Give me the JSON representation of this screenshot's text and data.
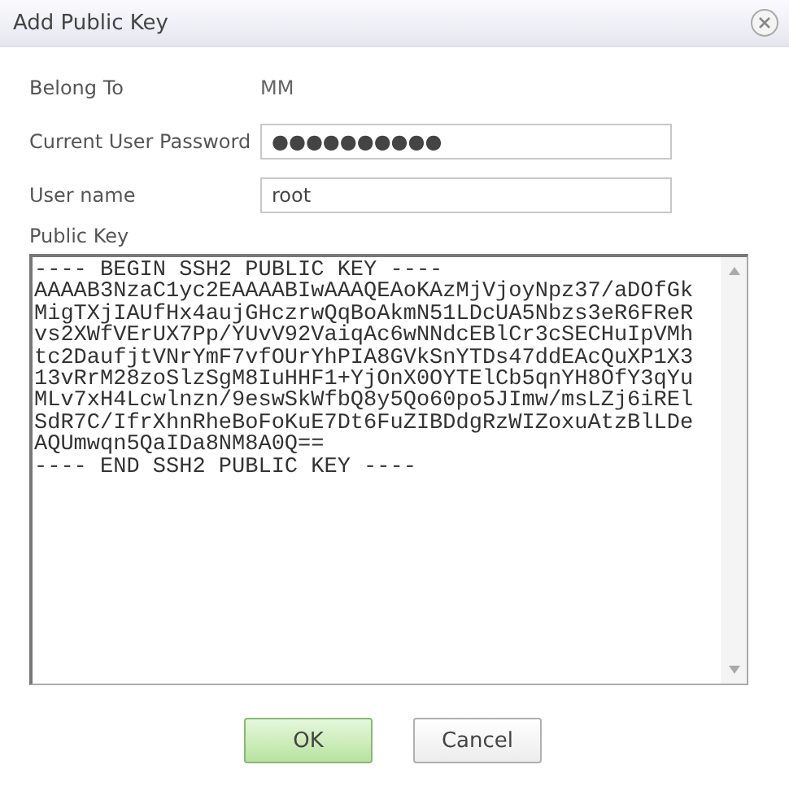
{
  "window": {
    "title": "Add Public Key"
  },
  "fields": [
    {
      "kind": "text",
      "label": "Belong To",
      "value": "MM"
    },
    {
      "kind": "input",
      "label": "Current User Password",
      "value": "●●●●●●●●●●"
    },
    {
      "kind": "input",
      "label": "User name",
      "value": "root"
    }
  ],
  "public_key": {
    "label": "Public Key",
    "lines": [
      "---- BEGIN SSH2 PUBLIC KEY ----",
      "AAAAB3NzaC1yc2EAAAABIwAAAQEAoKAzMjVjoyNpz37/aDOfGk",
      "MigTXjIAUfHx4aujGHczrwQqBoAkmN51LDcUA5Nbzs3eR6FReR",
      "vs2XWfVErUX7Pp/YUvV92VaiqAc6wNNdcEBlCr3cSECHuIpVMh",
      "tc2DaufjtVNrYmF7vfOUrYhPIA8GVkSnYTDs47ddEAcQuXP1X3",
      "13vRrM28zoSlzSgM8IuHHF1+YjOnX0OYTElCb5qnYH8OfY3qYu",
      "MLv7xH4Lcwlnzn/9eswSkWfbQ8y5Qo60po5JImw/msLZj6iREl",
      "SdR7C/IfrXhnRheBoFoKuE7Dt6FuZIBDdgRzWIZoxuAtzBlLDe",
      "AQUmwqn5QaIDa8NM8A0Q==",
      "---- END SSH2 PUBLIC KEY ----"
    ]
  },
  "buttons": [
    {
      "kind": "primary",
      "label": "OK"
    },
    {
      "kind": "secondary",
      "label": "Cancel"
    }
  ]
}
